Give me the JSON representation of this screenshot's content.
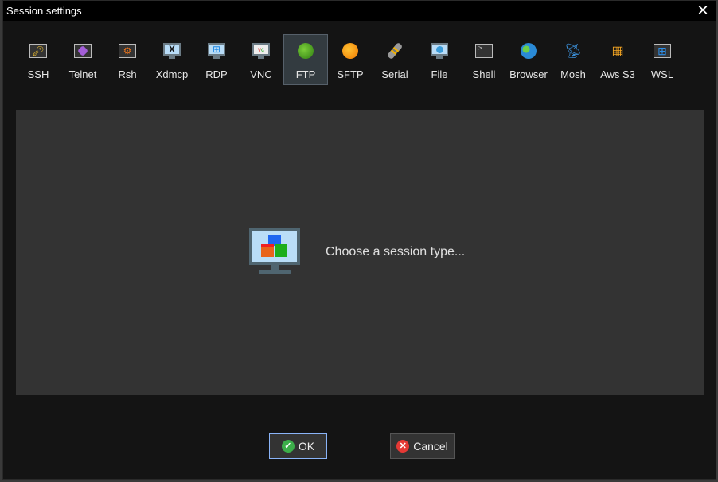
{
  "window": {
    "title": "Session settings",
    "close_icon": "close-icon"
  },
  "toolbar": {
    "items": [
      {
        "label": "SSH",
        "icon": "key-icon"
      },
      {
        "label": "Telnet",
        "icon": "telnet-gem-icon"
      },
      {
        "label": "Rsh",
        "icon": "gears-icon"
      },
      {
        "label": "Xdmcp",
        "icon": "x-monitor-icon"
      },
      {
        "label": "RDP",
        "icon": "windows-monitor-icon"
      },
      {
        "label": "VNC",
        "icon": "vnc-monitor-icon"
      },
      {
        "label": "FTP",
        "icon": "green-globe-icon",
        "selected": true
      },
      {
        "label": "SFTP",
        "icon": "orange-globe-icon"
      },
      {
        "label": "Serial",
        "icon": "serial-plug-icon"
      },
      {
        "label": "File",
        "icon": "file-monitor-icon"
      },
      {
        "label": "Shell",
        "icon": "terminal-icon"
      },
      {
        "label": "Browser",
        "icon": "earth-globe-icon"
      },
      {
        "label": "Mosh",
        "icon": "satellite-dish-icon"
      },
      {
        "label": "Aws S3",
        "icon": "aws-cubes-icon"
      },
      {
        "label": "WSL",
        "icon": "windows-box-icon"
      }
    ]
  },
  "main": {
    "message": "Choose a session type..."
  },
  "buttons": {
    "ok": "OK",
    "cancel": "Cancel"
  },
  "colors": {
    "selected_bg": "#333b40",
    "panel_bg": "#333333",
    "ok_border": "#8ab4f8",
    "ok_icon": "#3cae4a",
    "cancel_icon": "#e53935"
  }
}
